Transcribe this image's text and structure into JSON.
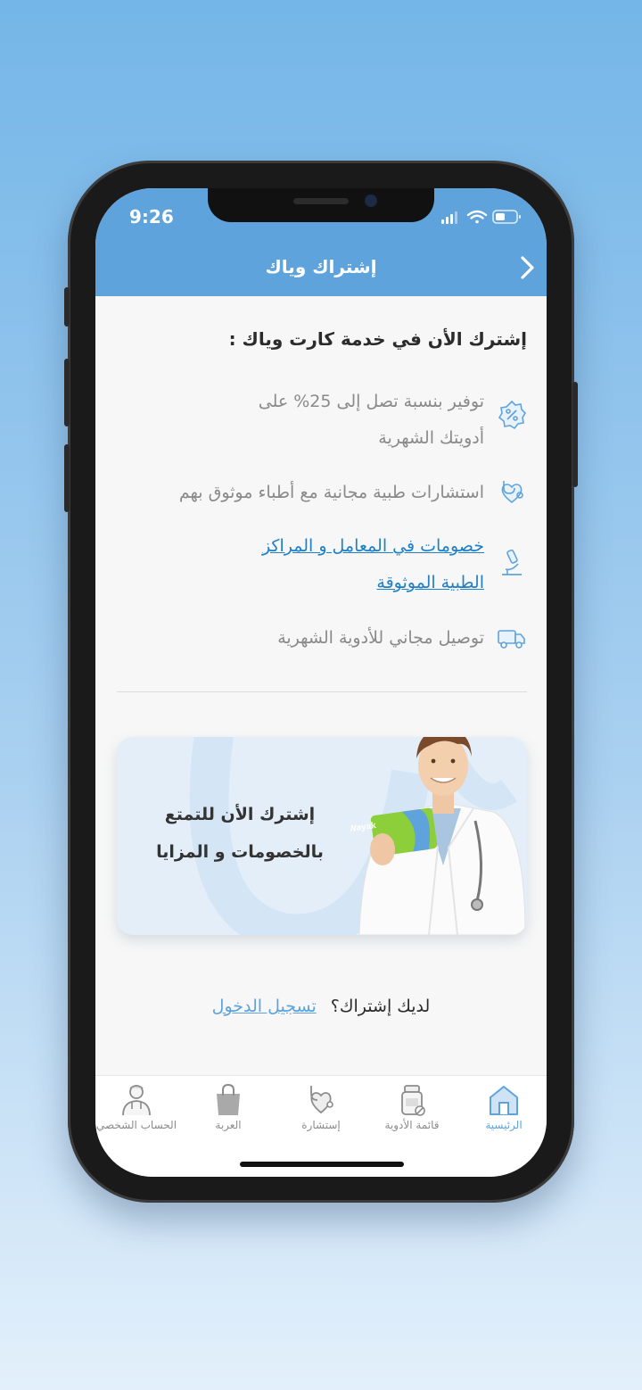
{
  "status_bar": {
    "time": "9:26"
  },
  "header": {
    "title": "إشتراك وياك"
  },
  "intro": {
    "heading": "إشترك الأن في خدمة كارت وياك :"
  },
  "features": [
    {
      "icon": "discount-badge-icon",
      "lines": [
        "توفير بنسبة تصل إلى 25% على",
        "أدويتك الشهرية"
      ],
      "link": false
    },
    {
      "icon": "stethoscope-heart-icon",
      "lines": [
        "استشارات طبية مجانية مع أطباء موثوق بهم"
      ],
      "link": false
    },
    {
      "icon": "microscope-icon",
      "lines": [
        "خصومات في المعامل و المراكز",
        "الطبية الموثوقة"
      ],
      "link": true
    },
    {
      "icon": "delivery-truck-icon",
      "lines": [
        "توصيل مجاني للأدوية الشهرية"
      ],
      "link": false
    }
  ],
  "promo": {
    "line1": "إشترك الأن للتمتع",
    "line2": "بالخصومات و المزايا",
    "card_brand": "Wayak"
  },
  "login": {
    "question": "لديك إشتراك؟",
    "link": "تسجيل الدخول"
  },
  "tabs": [
    {
      "label": "الرئيسية",
      "icon": "home-icon",
      "active": true
    },
    {
      "label": "قائمة الأدوية",
      "icon": "medicine-bottle-icon",
      "active": false
    },
    {
      "label": "إستشارة",
      "icon": "consultation-icon",
      "active": false
    },
    {
      "label": "العربة",
      "icon": "shopping-bag-icon",
      "active": false
    },
    {
      "label": "الحساب الشخصي",
      "icon": "doctor-profile-icon",
      "active": false
    }
  ],
  "colors": {
    "accent": "#5fa3dd",
    "link": "#1f7fc7",
    "text_muted": "#8a8a8a"
  }
}
